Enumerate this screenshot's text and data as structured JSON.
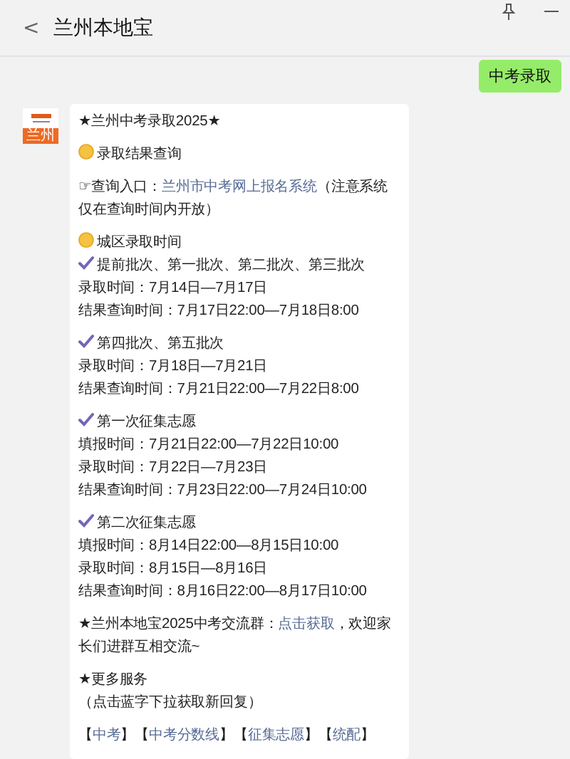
{
  "header": {
    "back": "<",
    "title": "兰州本地宝"
  },
  "sent": {
    "text": "中考录取"
  },
  "avatar": {
    "label": "兰州"
  },
  "message": {
    "paragraphs": [
      {
        "lines": [
          {
            "kind": "plain",
            "parts": [
              {
                "text": "★兰州中考录取2025★",
                "link": false
              }
            ]
          }
        ]
      },
      {
        "lines": [
          {
            "kind": "sun",
            "parts": [
              {
                "text": "录取结果查询",
                "link": false
              }
            ]
          }
        ]
      },
      {
        "lines": [
          {
            "kind": "plain",
            "parts": [
              {
                "text": "☞查询入口：",
                "link": false
              },
              {
                "text": "兰州市中考网上报名系统",
                "link": true
              },
              {
                "text": "（注意系统仅在查询时间内开放）",
                "link": false
              }
            ]
          }
        ]
      },
      {
        "lines": [
          {
            "kind": "sun",
            "parts": [
              {
                "text": "城区录取时间",
                "link": false
              }
            ]
          },
          {
            "kind": "check",
            "parts": [
              {
                "text": "提前批次、第一批次、第二批次、第三批次",
                "link": false
              }
            ]
          },
          {
            "kind": "plain",
            "parts": [
              {
                "text": "录取时间：7月14日—7月17日",
                "link": false
              }
            ]
          },
          {
            "kind": "plain",
            "parts": [
              {
                "text": "结果查询时间：7月17日22:00—7月18日8:00",
                "link": false
              }
            ]
          }
        ]
      },
      {
        "lines": [
          {
            "kind": "check",
            "parts": [
              {
                "text": "第四批次、第五批次",
                "link": false
              }
            ]
          },
          {
            "kind": "plain",
            "parts": [
              {
                "text": "录取时间：7月18日—7月21日",
                "link": false
              }
            ]
          },
          {
            "kind": "plain",
            "parts": [
              {
                "text": "结果查询时间：7月21日22:00—7月22日8:00",
                "link": false
              }
            ]
          }
        ]
      },
      {
        "lines": [
          {
            "kind": "check",
            "parts": [
              {
                "text": "第一次征集志愿",
                "link": false
              }
            ]
          },
          {
            "kind": "plain",
            "parts": [
              {
                "text": "填报时间：7月21日22:00—7月22日10:00",
                "link": false
              }
            ]
          },
          {
            "kind": "plain",
            "parts": [
              {
                "text": "录取时间：7月22日—7月23日",
                "link": false
              }
            ]
          },
          {
            "kind": "plain",
            "parts": [
              {
                "text": "结果查询时间：7月23日22:00—7月24日10:00",
                "link": false
              }
            ]
          }
        ]
      },
      {
        "lines": [
          {
            "kind": "check",
            "parts": [
              {
                "text": "第二次征集志愿",
                "link": false
              }
            ]
          },
          {
            "kind": "plain",
            "parts": [
              {
                "text": "填报时间：8月14日22:00—8月15日10:00",
                "link": false
              }
            ]
          },
          {
            "kind": "plain",
            "parts": [
              {
                "text": "录取时间：8月15日—8月16日",
                "link": false
              }
            ]
          },
          {
            "kind": "plain",
            "parts": [
              {
                "text": "结果查询时间：8月16日22:00—8月17日10:00",
                "link": false
              }
            ]
          }
        ]
      },
      {
        "lines": [
          {
            "kind": "plain",
            "parts": [
              {
                "text": "★兰州本地宝2025中考交流群：",
                "link": false
              },
              {
                "text": "点击获取",
                "link": true
              },
              {
                "text": "，欢迎家长们进群互相交流~",
                "link": false
              }
            ]
          }
        ]
      },
      {
        "lines": [
          {
            "kind": "plain",
            "parts": [
              {
                "text": "★更多服务",
                "link": false
              }
            ]
          },
          {
            "kind": "plain",
            "parts": [
              {
                "text": "（点击蓝字下拉获取新回复）",
                "link": false
              }
            ]
          }
        ]
      },
      {
        "lines": [
          {
            "kind": "plain",
            "parts": [
              {
                "text": "【",
                "link": false
              },
              {
                "text": "中考",
                "link": true
              },
              {
                "text": "】【",
                "link": false
              },
              {
                "text": "中考分数线",
                "link": true
              },
              {
                "text": "】【",
                "link": false
              },
              {
                "text": "征集志愿",
                "link": true
              },
              {
                "text": "】【",
                "link": false
              },
              {
                "text": "统配",
                "link": true
              },
              {
                "text": "】",
                "link": false
              }
            ]
          }
        ]
      }
    ]
  }
}
